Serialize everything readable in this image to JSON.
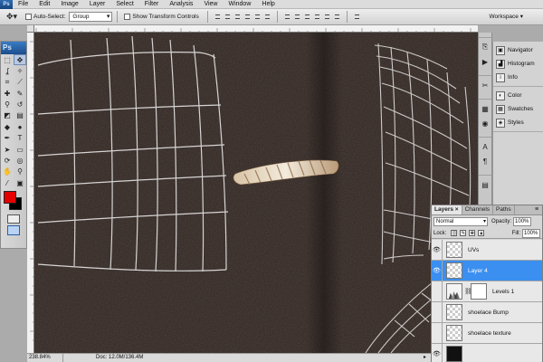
{
  "menubar": {
    "items": [
      "File",
      "Edit",
      "Image",
      "Layer",
      "Select",
      "Filter",
      "Analysis",
      "View",
      "Window",
      "Help"
    ]
  },
  "options": {
    "auto_select_label": "Auto-Select:",
    "auto_select_value": "Group",
    "show_transform_label": "Show Transform Controls",
    "workspace_label": "Workspace"
  },
  "toolbox": {
    "logo": "Ps",
    "foreground_color": "#e40000",
    "background_color": "#000000"
  },
  "panels": {
    "collapsed": [
      {
        "label": "Navigator",
        "icon": "navigator-icon"
      },
      {
        "label": "Histogram",
        "icon": "histogram-icon"
      },
      {
        "label": "Info",
        "icon": "info-icon"
      },
      {
        "label": "Color",
        "icon": "color-icon"
      },
      {
        "label": "Swatches",
        "icon": "swatches-icon"
      },
      {
        "label": "Styles",
        "icon": "styles-icon"
      }
    ]
  },
  "layers": {
    "tabs": [
      "Layers",
      "Channels",
      "Paths"
    ],
    "blend_mode": "Normal",
    "opacity_label": "Opacity:",
    "opacity": "100%",
    "lock_label": "Lock:",
    "fill_label": "Fill:",
    "fill": "100%",
    "items": [
      {
        "name": "UVs",
        "visible": true,
        "selected": false,
        "type": "raster"
      },
      {
        "name": "Layer 4",
        "visible": true,
        "selected": true,
        "type": "raster"
      },
      {
        "name": "Levels 1",
        "visible": false,
        "selected": false,
        "type": "adjustment"
      },
      {
        "name": "shoelace Bump",
        "visible": false,
        "selected": false,
        "type": "raster"
      },
      {
        "name": "shoelace texture",
        "visible": false,
        "selected": false,
        "type": "raster"
      }
    ]
  },
  "status": {
    "zoom": "238.84%",
    "doc": "Doc: 12.0M/136.4M"
  }
}
